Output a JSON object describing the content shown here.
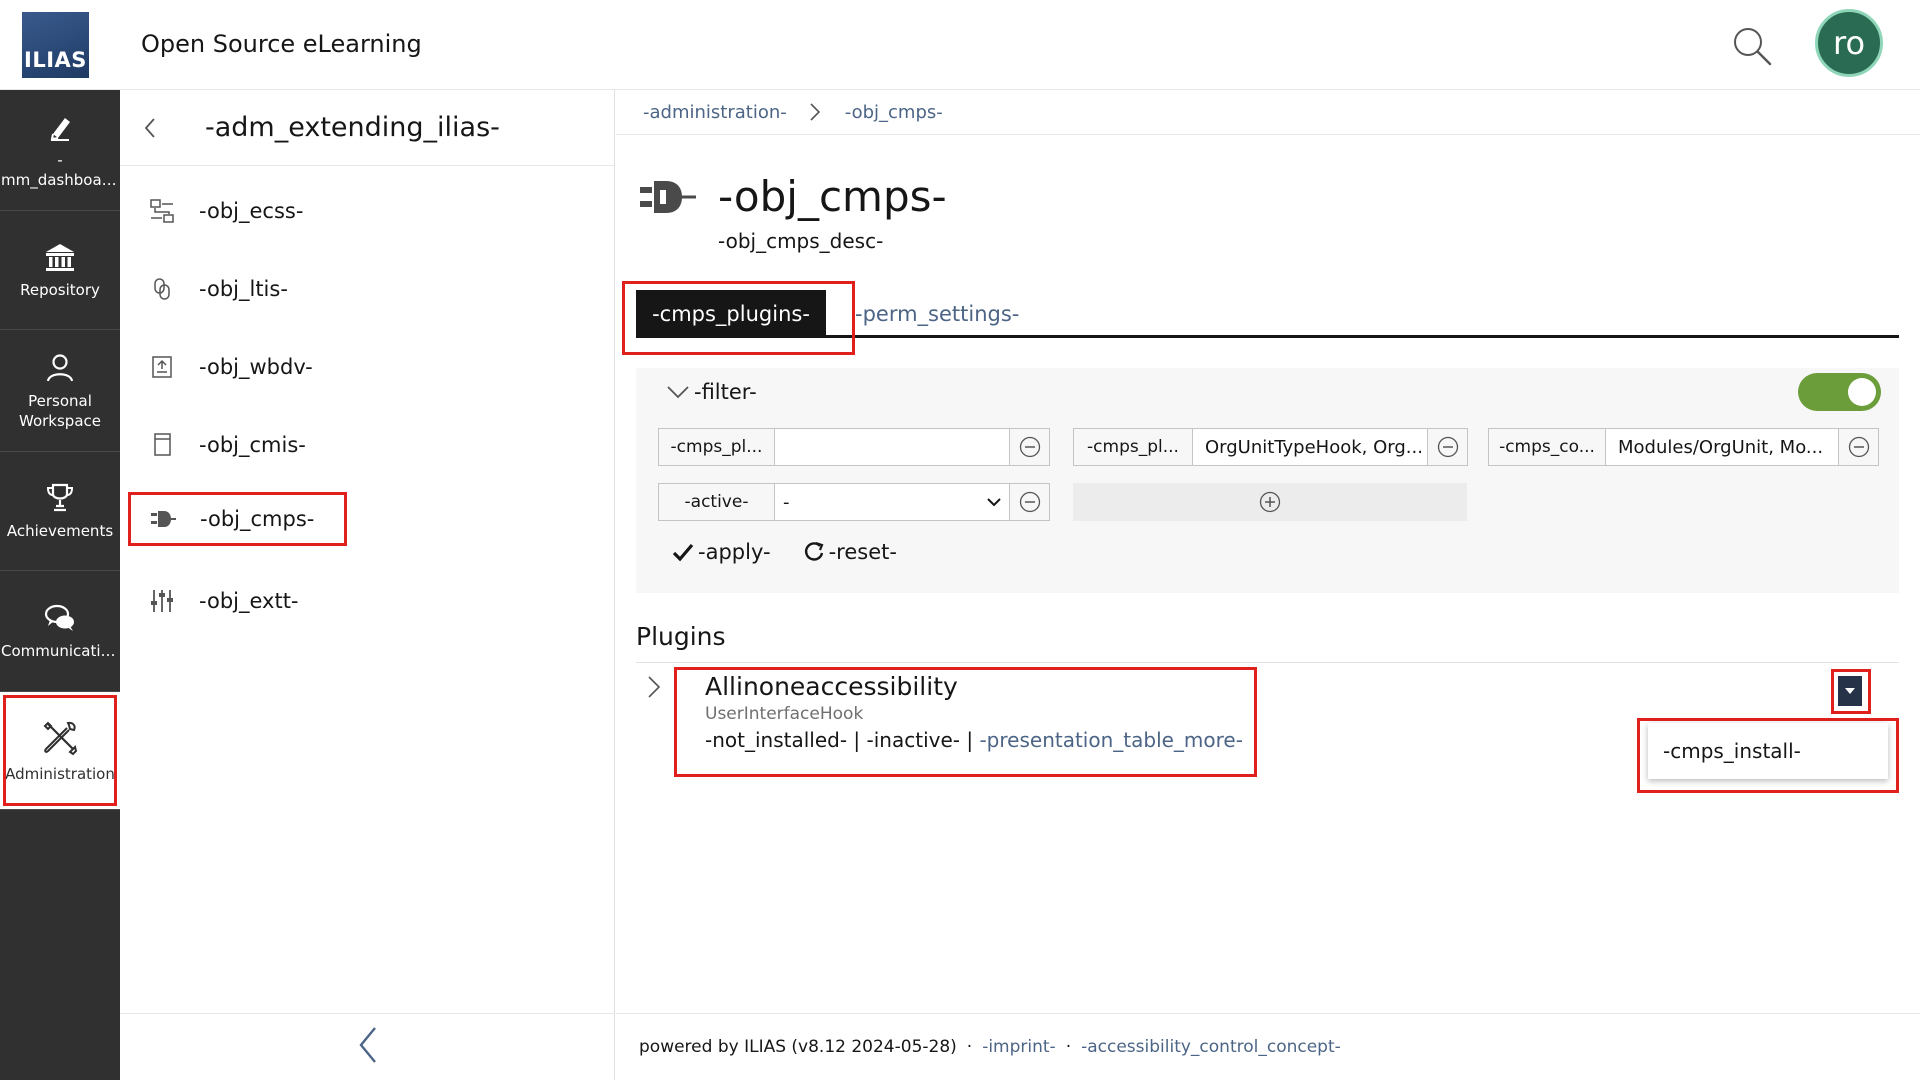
{
  "header": {
    "logo_text": "ILIAS",
    "title": "Open Source eLearning",
    "avatar_initials": "ro"
  },
  "mainbar": {
    "items": [
      {
        "label": "-\nmm_dashboar...",
        "icon": "pen-icon"
      },
      {
        "label": "Repository",
        "icon": "bank-icon"
      },
      {
        "label": "Personal Workspace",
        "icon": "person-icon"
      },
      {
        "label": "Achievements",
        "icon": "trophy-icon"
      },
      {
        "label": "Communication",
        "icon": "chat-icon"
      },
      {
        "label": "Administration",
        "icon": "tools-icon"
      }
    ]
  },
  "slate": {
    "title": "-adm_extending_ilias-",
    "entries": [
      {
        "label": "-obj_ecss-"
      },
      {
        "label": "-obj_ltis-"
      },
      {
        "label": "-obj_wbdv-"
      },
      {
        "label": "-obj_cmis-"
      },
      {
        "label": "-obj_cmps-"
      },
      {
        "label": "-obj_extt-"
      }
    ]
  },
  "breadcrumb": {
    "items": [
      "-administration-",
      "-obj_cmps-"
    ]
  },
  "page": {
    "title": "-obj_cmps-",
    "description": "-obj_cmps_desc-"
  },
  "tabs": {
    "active": "-cmps_plugins-",
    "other": "-perm_settings-"
  },
  "filter": {
    "toggle_label": "-filter-",
    "enabled": true,
    "fields": [
      {
        "label": "-cmps_pl...",
        "value": ""
      },
      {
        "label": "-cmps_pl...",
        "value": "OrgUnitTypeHook, Org..."
      },
      {
        "label": "-cmps_co...",
        "value": "Modules/OrgUnit, Mo..."
      },
      {
        "label": "-active-",
        "value": "-"
      }
    ],
    "apply_label": "-apply-",
    "reset_label": "-reset-"
  },
  "plugins": {
    "section_title": "Plugins",
    "items": [
      {
        "name": "Allinoneaccessibility",
        "slot": "UserInterfaceHook",
        "status_installed": "-not_installed-",
        "status_active": "-inactive-",
        "more": "-presentation_table_more-",
        "separator": "|"
      }
    ],
    "dropdown_action": "-cmps_install-"
  },
  "footer": {
    "powered_by": "powered by ILIAS (v8.12 2024-05-28)",
    "separator": "·",
    "imprint": "-imprint-",
    "accessibility": "-accessibility_control_concept-"
  },
  "colors": {
    "mainbar_bg": "#303030",
    "highlight_red": "#e0201c",
    "link": "#4c6586",
    "toggle_on": "#6b9e3a",
    "avatar_bg": "#2a6b53"
  }
}
